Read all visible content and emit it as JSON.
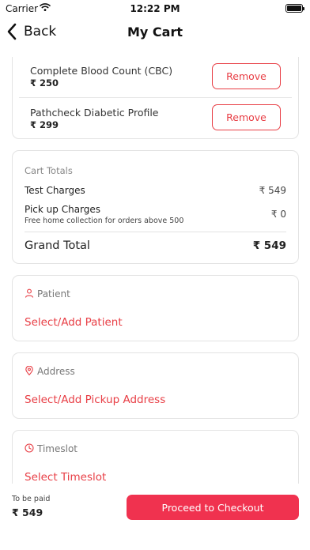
{
  "status_bar": {
    "carrier": "Carrier",
    "time": "12:22 PM"
  },
  "nav": {
    "back_label": "Back",
    "title": "My Cart"
  },
  "cart_items": [
    {
      "name": "Complete Blood Count (CBC)",
      "price": "₹ 250",
      "action": "Remove"
    },
    {
      "name": "Pathcheck Diabetic Profile",
      "price": "₹ 299",
      "action": "Remove"
    }
  ],
  "totals": {
    "heading": "Cart Totals",
    "test_charges_label": "Test Charges",
    "test_charges_value": "₹ 549",
    "pickup_label": "Pick up Charges",
    "pickup_note": "Free home collection for orders above 500",
    "pickup_value": "₹ 0",
    "grand_label": "Grand Total",
    "grand_value": "₹ 549"
  },
  "patient": {
    "heading": "Patient",
    "action": "Select/Add Patient",
    "icon": "person-icon"
  },
  "address": {
    "heading": "Address",
    "action": "Select/Add Pickup Address",
    "icon": "location-pin-icon"
  },
  "timeslot": {
    "heading": "Timeslot",
    "action": "Select Timeslot",
    "icon": "clock-icon"
  },
  "footer": {
    "to_be_paid_label": "To be paid",
    "to_be_paid_amount": "₹ 549",
    "checkout_label": "Proceed to Checkout"
  },
  "colors": {
    "accent": "#e83e45",
    "checkout_button": "#f0324f",
    "border": "#e3e3e3"
  }
}
